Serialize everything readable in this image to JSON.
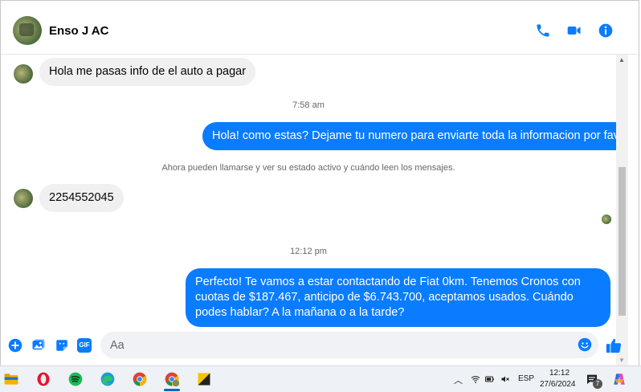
{
  "header": {
    "contact_name": "Enso J AC"
  },
  "messages": {
    "m1": "Hola me pasas info de el auto a pagar",
    "t1": "7:58 am",
    "m2": "Hola! como estas? Dejame tu numero para enviarte toda la informacion por favor!",
    "notice": "Ahora pueden llamarse y ver su estado activo y cuándo leen los mensajes.",
    "m3": "2254552045",
    "t2": "12:12 pm",
    "m4": "Perfecto! Te vamos a estar contactando de Fiat 0km. Tenemos Cronos con cuotas de $187.467, anticipo de $6.743.700, aceptamos usados. Cuándo podes hablar? A la mañana o a la tarde?"
  },
  "composer": {
    "placeholder": "Aa",
    "gif_label": "GIF"
  },
  "taskbar": {
    "lang": "ESP",
    "time": "12:12",
    "date": "27/6/2024",
    "notif_count": "7"
  },
  "colors": {
    "accent": "#0a7cff",
    "bubble_in": "#f0f0f0"
  }
}
